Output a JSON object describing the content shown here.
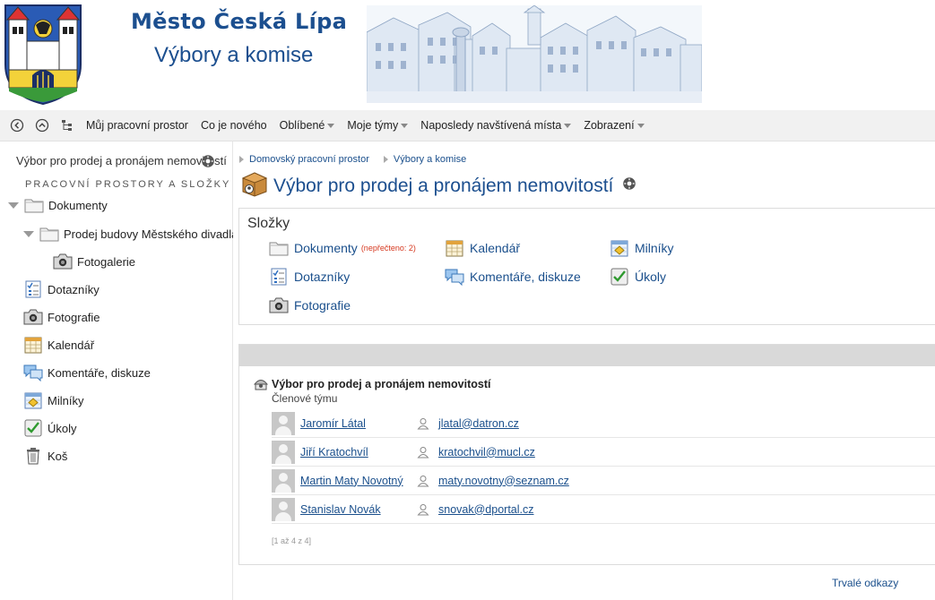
{
  "banner": {
    "site_title": "Město Česká Lípa",
    "site_subtitle": "Výbory a komise"
  },
  "topnav": {
    "items": [
      {
        "label": "Můj pracovní prostor",
        "dropdown": false
      },
      {
        "label": "Co je nového",
        "dropdown": false
      },
      {
        "label": "Oblíbené",
        "dropdown": true
      },
      {
        "label": "Moje týmy",
        "dropdown": true
      },
      {
        "label": "Naposledy navštívená místa",
        "dropdown": true
      },
      {
        "label": "Zobrazení",
        "dropdown": true
      }
    ]
  },
  "sidebar": {
    "title": "Výbor pro prodej a pronájem nemovitostí",
    "caption": "PRACOVNÍ PROSTORY A SLOŽKY",
    "tree": [
      {
        "label": "Dokumenty",
        "icon": "folder-icon"
      },
      {
        "label": "Prodej budovy Městského divadla",
        "icon": "folder-icon"
      },
      {
        "label": "Fotogalerie",
        "icon": "camera-icon"
      },
      {
        "label": "Dotazníky",
        "icon": "survey-icon"
      },
      {
        "label": "Fotografie",
        "icon": "camera-icon"
      },
      {
        "label": "Kalendář",
        "icon": "calendar-icon"
      },
      {
        "label": "Komentáře, diskuze",
        "icon": "comments-icon"
      },
      {
        "label": "Milníky",
        "icon": "milestones-icon"
      },
      {
        "label": "Úkoly",
        "icon": "tasks-icon"
      },
      {
        "label": "Koš",
        "icon": "trash-icon"
      }
    ]
  },
  "breadcrumb": [
    {
      "label": "Domovský pracovní prostor"
    },
    {
      "label": "Výbory a komise"
    }
  ],
  "page": {
    "title": "Výbor pro prodej a pronájem nemovitostí"
  },
  "folders": {
    "heading": "Složky",
    "items": [
      {
        "label": "Dokumenty",
        "badge": "(nepřečteno: 2)",
        "icon": "folder-icon"
      },
      {
        "label": "Dotazníky",
        "icon": "survey-icon"
      },
      {
        "label": "Fotografie",
        "icon": "camera-icon"
      },
      {
        "label": "Kalendář",
        "icon": "calendar-icon"
      },
      {
        "label": "Komentáře, diskuze",
        "icon": "comments-icon"
      },
      {
        "label": "Milníky",
        "icon": "milestones-icon"
      },
      {
        "label": "Úkoly",
        "icon": "tasks-icon"
      }
    ]
  },
  "team": {
    "title": "Výbor pro prodej a pronájem nemovitostí",
    "subtitle": "Členové týmu",
    "members": [
      {
        "name": "Jaromír Látal",
        "email": "jlatal@datron.cz"
      },
      {
        "name": "Jiří Kratochvíl",
        "email": "kratochvil@mucl.cz"
      },
      {
        "name": "Martin Maty Novotný",
        "email": "maty.novotny@seznam.cz"
      },
      {
        "name": "Stanislav Novák",
        "email": "snovak@dportal.cz"
      }
    ],
    "pager": "[1 až 4 z 4]"
  },
  "footer": {
    "permalinks": "Trvalé odkazy"
  },
  "colors": {
    "brand_blue": "#1c4f8f",
    "link_blue": "#1a4f8c",
    "unread_red": "#d6381f",
    "nav_background": "#f1f1f1"
  }
}
